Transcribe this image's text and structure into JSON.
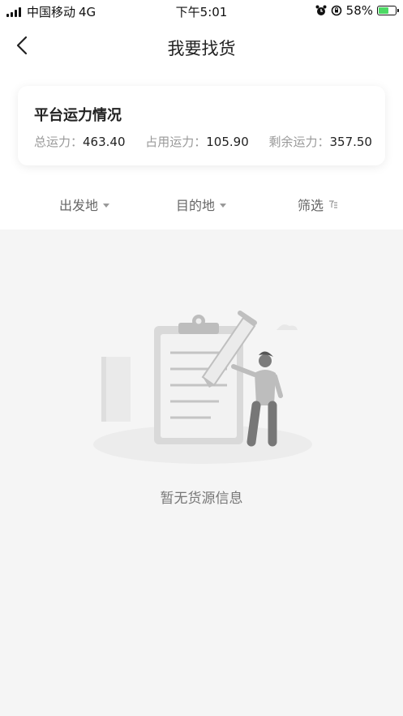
{
  "status_bar": {
    "carrier": "中国移动",
    "network": "4G",
    "time": "下午5:01",
    "battery": "58%"
  },
  "nav": {
    "title": "我要找货"
  },
  "capacity_card": {
    "title": "平台运力情况",
    "stats": [
      {
        "label": "总运力：",
        "value": "463.40"
      },
      {
        "label": "占用运力：",
        "value": "105.90"
      },
      {
        "label": "剩余运力：",
        "value": "357.50"
      }
    ]
  },
  "filters": {
    "origin": "出发地",
    "destination": "目的地",
    "filter": "筛选"
  },
  "empty_state": {
    "message": "暂无货源信息"
  },
  "colors": {
    "battery_fill": "#4cd964",
    "background": "#f5f5f5"
  }
}
